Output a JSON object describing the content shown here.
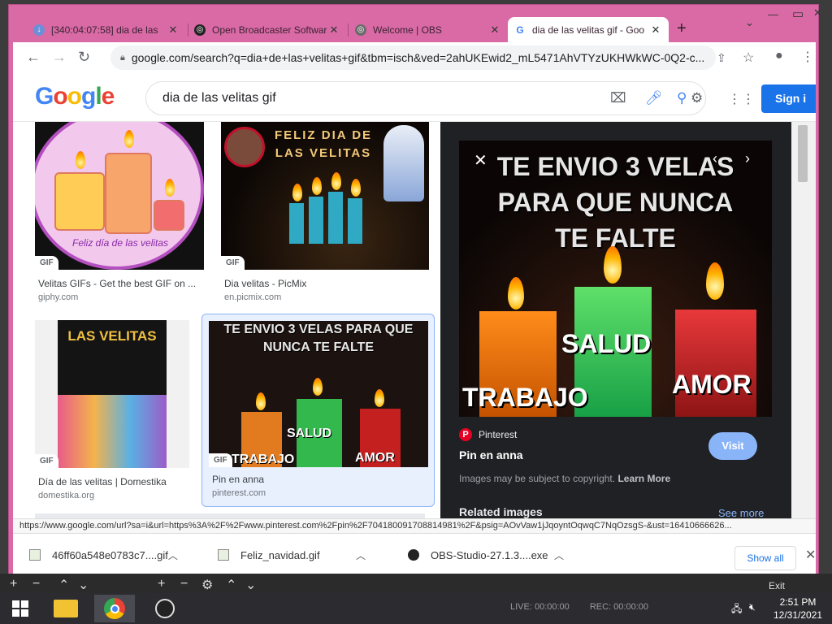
{
  "browser": {
    "tabs": [
      {
        "title": "[340:04:07:58] dia de las",
        "favicon": "download-arrow-icon",
        "active": false
      },
      {
        "title": "Open Broadcaster Software",
        "favicon": "obs-logo-icon",
        "active": false
      },
      {
        "title": "Welcome | OBS",
        "favicon": "obs-globe-icon",
        "active": false
      },
      {
        "title": "dia de las velitas gif - Goo",
        "favicon": "google-g-icon",
        "active": true
      }
    ],
    "url": "google.com/search?q=dia+de+las+velitas+gif&tbm=isch&ved=2ahUKEwid2_mL5471AhVTYzUKHWkWC-0Q2-c...",
    "window_title_bg": "#d96aa5"
  },
  "google": {
    "logo": "Google",
    "query": "dia de las velitas gif",
    "signin_label": "Sign i"
  },
  "results": [
    {
      "title": "Velitas GIFs - Get the best GIF on ...",
      "source": "giphy.com",
      "badge": "GIF",
      "caption": "Feliz día de las velitas"
    },
    {
      "title": "Dia velitas - PicMix",
      "source": "en.picmix.com",
      "badge": "GIF",
      "caption": "FELIZ DIA DE LAS VELITAS"
    },
    {
      "title": "Día de las velitas | Domestika",
      "source": "domestika.org",
      "badge": "GIF",
      "caption": "LAS VELITAS"
    },
    {
      "title": "Pin en anna",
      "source": "pinterest.com",
      "badge": "GIF",
      "caption": "TE ENVIO 3 VELAS PARA QUE NUNCA TE FALTE"
    }
  ],
  "preview": {
    "image_text": [
      "TE ENVIO 3 VELAS",
      "PARA QUE NUNCA",
      "TE FALTE"
    ],
    "labels": {
      "health": "SALUD",
      "work": "TRABAJO",
      "love": "AMOR"
    },
    "site": "Pinterest",
    "title": "Pin en anna",
    "visit_label": "Visit",
    "copyright_text": "Images may be subject to copyright.",
    "learn_more": "Learn More",
    "related_label": "Related images",
    "see_more": "See more"
  },
  "status_url": "https://www.google.com/url?sa=i&url=https%3A%2F%2Fwww.pinterest.com%2Fpin%2F704180091708814981%2F&psig=AOvVaw1jJqoyntOqwqC7NqOzsgS-&ust=16410666626...",
  "downloads": [
    {
      "name": "46ff60a548e0783c7....gif",
      "icon": "image-file-icon"
    },
    {
      "name": "Feliz_navidad.gif",
      "icon": "image-file-icon"
    },
    {
      "name": "OBS-Studio-27.1.3....exe",
      "icon": "obs-logo-icon"
    }
  ],
  "download_show_all": "Show all",
  "obs": {
    "exit_label": "Exit",
    "live": "LIVE: 00:00:00",
    "rec": "REC: 00:00:00"
  },
  "taskbar": {
    "time": "2:51 PM",
    "date": "12/31/2021"
  }
}
